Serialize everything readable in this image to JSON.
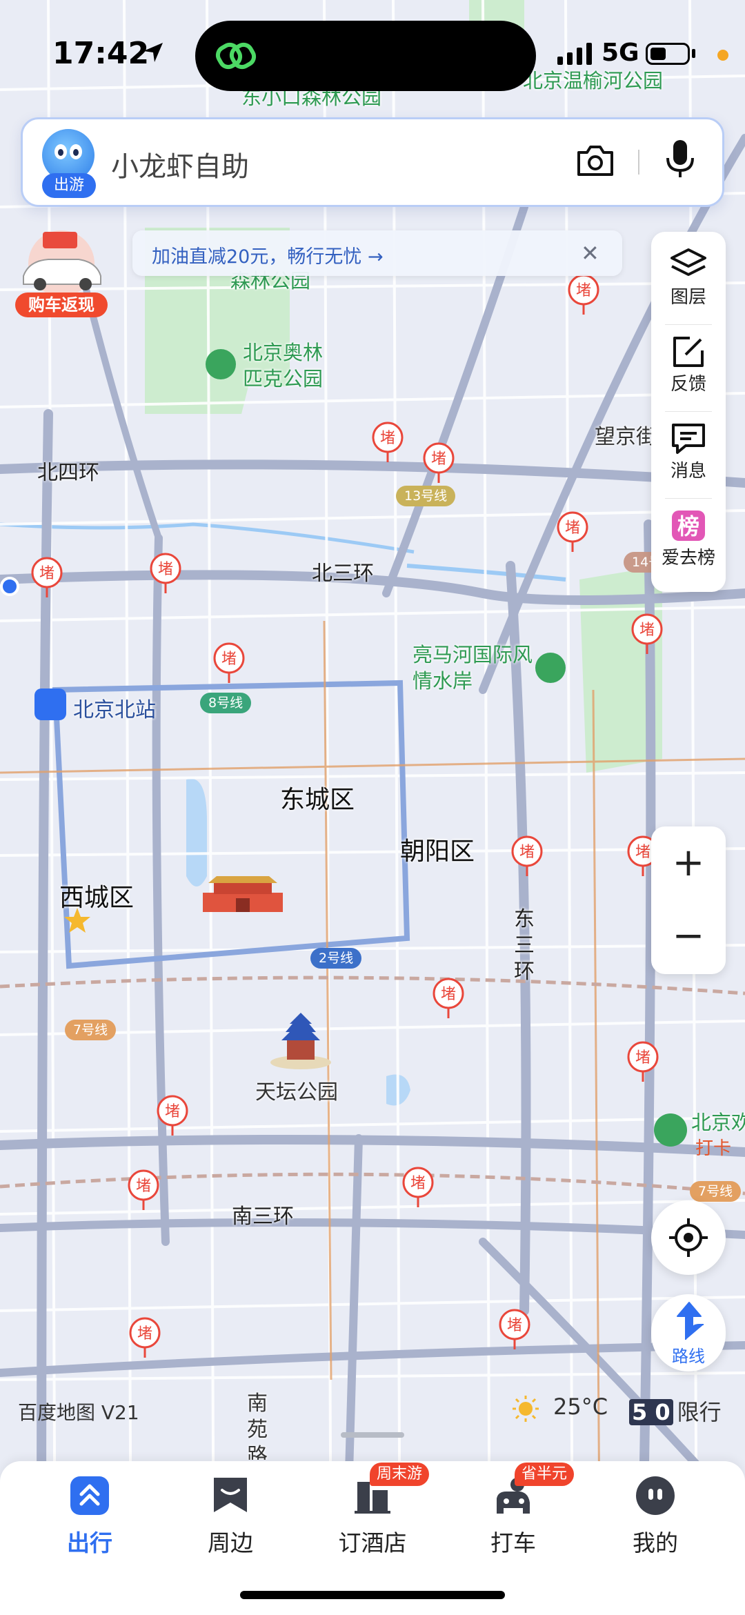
{
  "status_bar": {
    "time": "17:42",
    "network": "5G"
  },
  "search": {
    "badge": "出游",
    "placeholder": "小龙虾自助",
    "camera_icon": "camera-icon",
    "mic_icon": "microphone-icon"
  },
  "promo": {
    "text": "加油直减20元，畅行无忧 →",
    "close": "✕"
  },
  "car_promo": {
    "label": "购车返现"
  },
  "side_panel": {
    "items": [
      {
        "label": "图层",
        "icon": "layers-icon"
      },
      {
        "label": "反馈",
        "icon": "feedback-icon"
      },
      {
        "label": "消息",
        "icon": "message-icon"
      },
      {
        "label": "爱去榜",
        "icon": "ranking-icon"
      }
    ]
  },
  "zoom": {
    "in": "+",
    "out": "−"
  },
  "route_button": {
    "label": "路线"
  },
  "map": {
    "districts": [
      "东城区",
      "西城区",
      "朝阳区"
    ],
    "ring_roads": [
      "北四环",
      "北三环",
      "南三环",
      "东三环"
    ],
    "parks": [
      "北京奥林匹克公园",
      "亮马河国际风情水岸",
      "东小口森林公园",
      "北京温榆河公园",
      "森林公园",
      "北京欢"
    ],
    "pois": [
      "天坛公园",
      "北京北站",
      "望京街",
      "南苑路"
    ],
    "line_pills": [
      "13号线",
      "8号线",
      "2号线",
      "7号线",
      "7号线",
      "14号"
    ],
    "jam_label": "堵",
    "checkin_label": "打卡"
  },
  "map_footer": {
    "watermark": "百度地图 V21",
    "temperature": "25°C",
    "restriction_digits": "5 0",
    "restriction_label": "限行"
  },
  "tabs": [
    {
      "label": "出行",
      "icon": "travel-icon",
      "active": true
    },
    {
      "label": "周边",
      "icon": "nearby-icon",
      "active": false
    },
    {
      "label": "订酒店",
      "icon": "hotel-icon",
      "active": false,
      "badge": "周末游"
    },
    {
      "label": "打车",
      "icon": "taxi-icon",
      "active": false,
      "badge": "省半元"
    },
    {
      "label": "我的",
      "icon": "profile-icon",
      "active": false
    }
  ],
  "colors": {
    "accent": "#2f6ff0",
    "jam": "#e9473b",
    "park": "#2e9a52",
    "map_bg": "#e9ecf5"
  }
}
